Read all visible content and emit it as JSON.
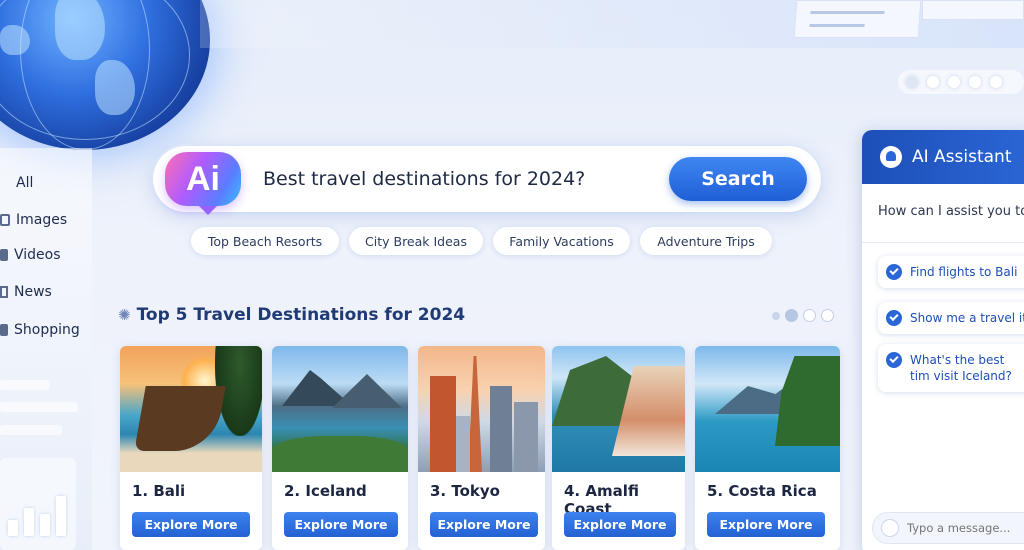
{
  "nav": {
    "items": [
      {
        "label": "All",
        "icon": "all-icon"
      },
      {
        "label": "Images",
        "icon": "image-icon"
      },
      {
        "label": "Videos",
        "icon": "video-icon"
      },
      {
        "label": "News",
        "icon": "news-icon"
      },
      {
        "label": "Shopping",
        "icon": "shopping-icon"
      }
    ]
  },
  "search": {
    "logo_text": "Ai",
    "query": "Best travel destinations for 2024?",
    "button_label": "Search"
  },
  "chips": [
    "Top Beach Resorts",
    "City Break Ideas",
    "Family Vacations",
    "Adventure Trips"
  ],
  "section": {
    "title": "Top 5 Travel Destinations for 2024"
  },
  "destinations": [
    {
      "name": "1. Bali",
      "button": "Explore More"
    },
    {
      "name": "2. Iceland",
      "button": "Explore More"
    },
    {
      "name": "3. Tokyo",
      "button": "Explore More"
    },
    {
      "name": "4. Amalfi Coast",
      "button": "Explore More"
    },
    {
      "name": "5. Costa Rica",
      "button": "Explore More"
    }
  ],
  "assistant": {
    "title": "AI Assistant",
    "greeting": "How can I assist you to",
    "suggestions": [
      "Find flights to Bali",
      "Show me a travel itin",
      "What's the best tim visit Iceland?"
    ],
    "message_placeholder": "Typo a message..."
  },
  "colors": {
    "accent": "#2b66d6",
    "title": "#1f3a74"
  }
}
